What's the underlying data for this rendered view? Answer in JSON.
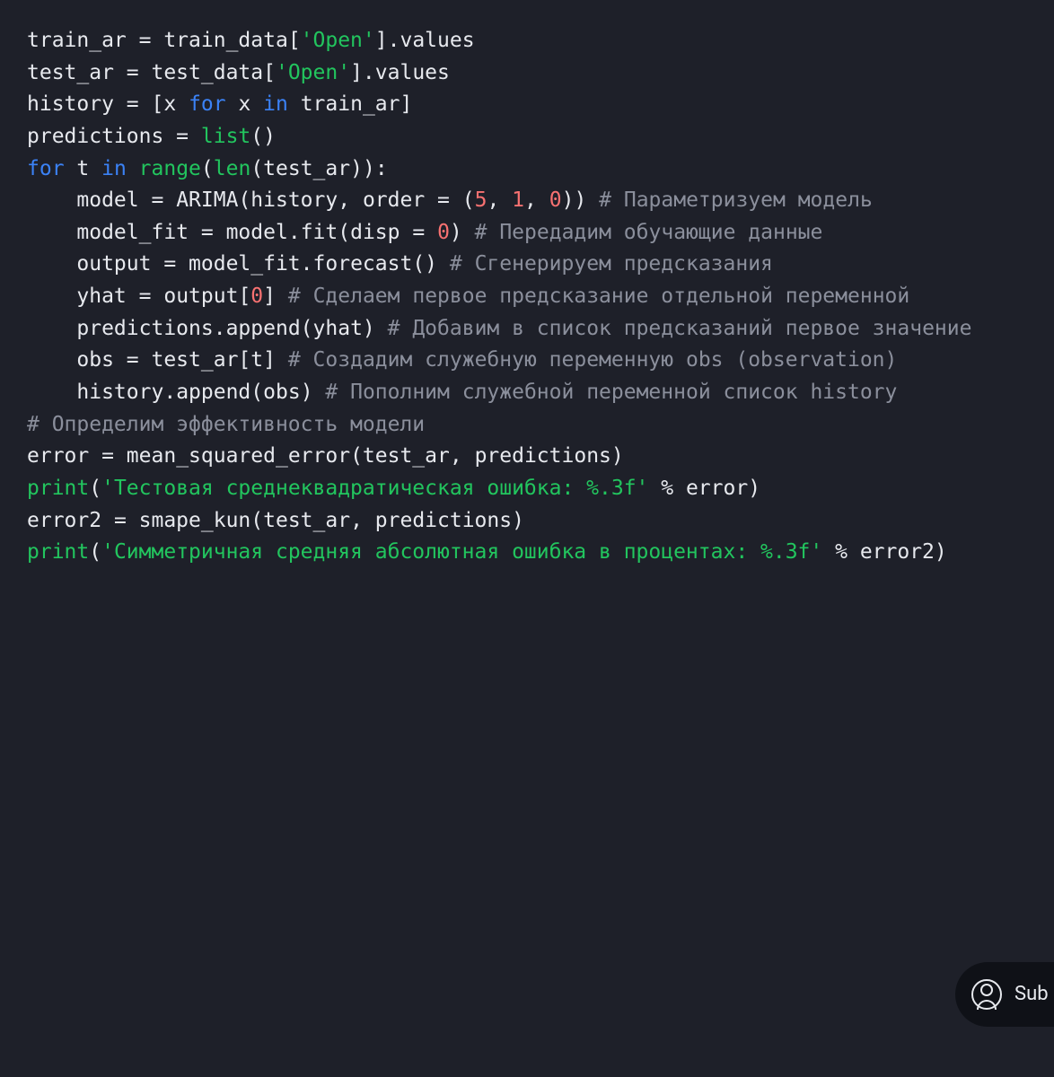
{
  "code": {
    "lines": [
      [
        [
          "default",
          "train_ar "
        ],
        [
          "op",
          "="
        ],
        [
          "default",
          " train_data"
        ],
        [
          "op",
          "["
        ],
        [
          "str",
          "'Open'"
        ],
        [
          "op",
          "]."
        ],
        [
          "default",
          "values"
        ]
      ],
      [
        [
          "default",
          "test_ar "
        ],
        [
          "op",
          "="
        ],
        [
          "default",
          " test_data"
        ],
        [
          "op",
          "["
        ],
        [
          "str",
          "'Open'"
        ],
        [
          "op",
          "]."
        ],
        [
          "default",
          "values"
        ]
      ],
      [],
      [
        [
          "default",
          "history "
        ],
        [
          "op",
          "="
        ],
        [
          "default",
          " "
        ],
        [
          "op",
          "["
        ],
        [
          "default",
          "x "
        ],
        [
          "kw",
          "for"
        ],
        [
          "default",
          " x "
        ],
        [
          "kw",
          "in"
        ],
        [
          "default",
          " train_ar"
        ],
        [
          "op",
          "]"
        ]
      ],
      [
        [
          "default",
          "predictions "
        ],
        [
          "op",
          "="
        ],
        [
          "default",
          " "
        ],
        [
          "builtin",
          "list"
        ],
        [
          "op",
          "()"
        ]
      ],
      [
        [
          "kw",
          "for"
        ],
        [
          "default",
          " t "
        ],
        [
          "kw",
          "in"
        ],
        [
          "default",
          " "
        ],
        [
          "builtin",
          "range"
        ],
        [
          "op",
          "("
        ],
        [
          "builtin",
          "len"
        ],
        [
          "op",
          "("
        ],
        [
          "default",
          "test_ar"
        ],
        [
          "op",
          "))"
        ],
        [
          "op",
          ":"
        ]
      ],
      [
        [
          "default",
          "    model "
        ],
        [
          "op",
          "="
        ],
        [
          "default",
          " ARIMA"
        ],
        [
          "op",
          "("
        ],
        [
          "default",
          "history"
        ],
        [
          "op",
          ","
        ],
        [
          "default",
          " order "
        ],
        [
          "op",
          "="
        ],
        [
          "default",
          " "
        ],
        [
          "op",
          "("
        ],
        [
          "num",
          "5"
        ],
        [
          "op",
          ", "
        ],
        [
          "num",
          "1"
        ],
        [
          "op",
          ", "
        ],
        [
          "num",
          "0"
        ],
        [
          "op",
          "))"
        ],
        [
          "default",
          " "
        ],
        [
          "comment",
          "# Параметризуем модель"
        ]
      ],
      [
        [
          "default",
          "    model_fit "
        ],
        [
          "op",
          "="
        ],
        [
          "default",
          " model"
        ],
        [
          "op",
          "."
        ],
        [
          "default",
          "fit"
        ],
        [
          "op",
          "("
        ],
        [
          "default",
          "disp "
        ],
        [
          "op",
          "="
        ],
        [
          "default",
          " "
        ],
        [
          "num",
          "0"
        ],
        [
          "op",
          ")"
        ],
        [
          "default",
          " "
        ],
        [
          "comment",
          "# Передадим обучающие данные"
        ]
      ],
      [
        [
          "default",
          "    output "
        ],
        [
          "op",
          "="
        ],
        [
          "default",
          " model_fit"
        ],
        [
          "op",
          "."
        ],
        [
          "default",
          "forecast"
        ],
        [
          "op",
          "()"
        ],
        [
          "default",
          " "
        ],
        [
          "comment",
          "# Сгенерируем предсказания"
        ]
      ],
      [
        [
          "default",
          "    yhat "
        ],
        [
          "op",
          "="
        ],
        [
          "default",
          " output"
        ],
        [
          "op",
          "["
        ],
        [
          "num",
          "0"
        ],
        [
          "op",
          "]"
        ],
        [
          "default",
          " "
        ],
        [
          "comment",
          "# Сделаем первое предсказание отдельной переменной"
        ]
      ],
      [
        [
          "default",
          "    predictions"
        ],
        [
          "op",
          "."
        ],
        [
          "default",
          "append"
        ],
        [
          "op",
          "("
        ],
        [
          "default",
          "yhat"
        ],
        [
          "op",
          ")"
        ],
        [
          "default",
          " "
        ],
        [
          "comment",
          "# Добавим в список предсказаний первое значение"
        ]
      ],
      [
        [
          "default",
          "    obs "
        ],
        [
          "op",
          "="
        ],
        [
          "default",
          " test_ar"
        ],
        [
          "op",
          "["
        ],
        [
          "default",
          "t"
        ],
        [
          "op",
          "]"
        ],
        [
          "default",
          " "
        ],
        [
          "comment",
          "# Создадим служебную переменную obs (observation)"
        ]
      ],
      [
        [
          "default",
          "    history"
        ],
        [
          "op",
          "."
        ],
        [
          "default",
          "append"
        ],
        [
          "op",
          "("
        ],
        [
          "default",
          "obs"
        ],
        [
          "op",
          ")"
        ],
        [
          "default",
          " "
        ],
        [
          "comment",
          "# Пополним служебной переменной список history"
        ]
      ],
      [],
      [
        [
          "comment",
          "# Определим эффективность модели"
        ]
      ],
      [
        [
          "default",
          "error "
        ],
        [
          "op",
          "="
        ],
        [
          "default",
          " mean_squared_error"
        ],
        [
          "op",
          "("
        ],
        [
          "default",
          "test_ar"
        ],
        [
          "op",
          ","
        ],
        [
          "default",
          " predictions"
        ],
        [
          "op",
          ")"
        ]
      ],
      [
        [
          "builtin",
          "print"
        ],
        [
          "op",
          "("
        ],
        [
          "str",
          "'Тестовая среднеквадратическая ошибка: %.3f'"
        ],
        [
          "default",
          " "
        ],
        [
          "op",
          "%"
        ],
        [
          "default",
          " error"
        ],
        [
          "op",
          ")"
        ]
      ],
      [
        [
          "default",
          "error2 "
        ],
        [
          "op",
          "="
        ],
        [
          "default",
          " smape_kun"
        ],
        [
          "op",
          "("
        ],
        [
          "default",
          "test_ar"
        ],
        [
          "op",
          ","
        ],
        [
          "default",
          " predictions"
        ],
        [
          "op",
          ")"
        ]
      ],
      [
        [
          "builtin",
          "print"
        ],
        [
          "op",
          "("
        ],
        [
          "str",
          "'Симметричная средняя абсолютная ошибка в процентах: %.3f'"
        ],
        [
          "default",
          " "
        ],
        [
          "op",
          "%"
        ],
        [
          "default",
          " error2"
        ],
        [
          "op",
          ")"
        ]
      ]
    ]
  },
  "submit": {
    "label": "Sub"
  }
}
